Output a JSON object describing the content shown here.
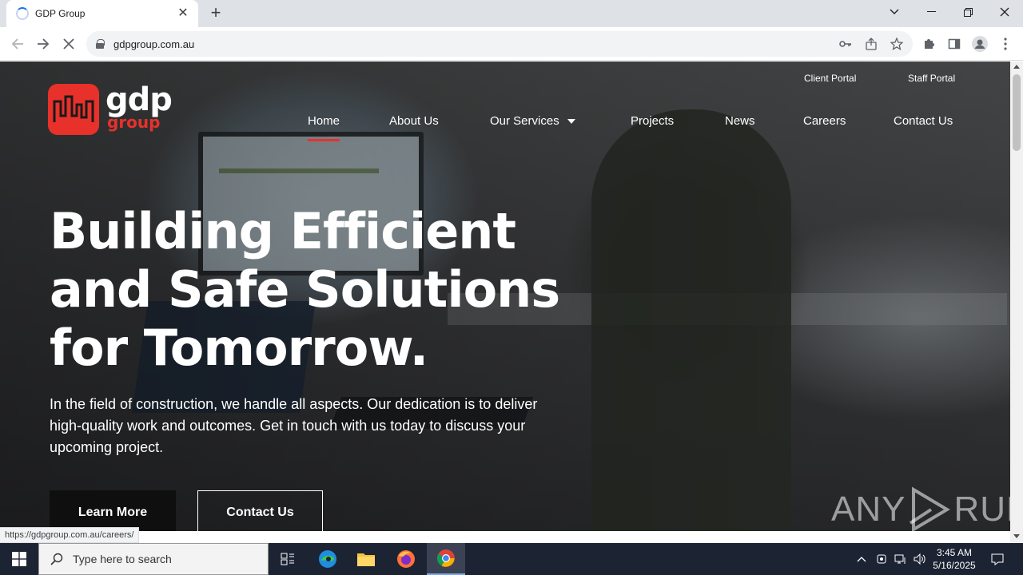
{
  "browser": {
    "tab_title": "GDP Group",
    "url": "gdpgroup.com.au",
    "status_url": "https://gdpgroup.com.au/careers/"
  },
  "site": {
    "logo_word": "gdp",
    "logo_sub": "group",
    "top_links": [
      "Client Portal",
      "Staff Portal"
    ],
    "nav": [
      "Home",
      "About Us",
      "Our Services",
      "Projects",
      "News",
      "Careers",
      "Contact Us"
    ],
    "active_nav": "Home",
    "headline_lines": [
      "Building Efficient",
      "and Safe Solutions",
      "for Tomorrow."
    ],
    "subtext_lines": [
      "In the field of construction, we handle all aspects. Our dedication is to deliver",
      "high-quality work and outcomes. Get in touch with us today to discuss your",
      "upcoming project."
    ],
    "buttons": {
      "learn_more": "Learn More",
      "contact_us": "Contact Us"
    },
    "watermark_left": "ANY",
    "watermark_right": "RUN"
  },
  "taskbar": {
    "search_placeholder": "Type here to search",
    "time": "3:45 AM",
    "date": "5/16/2025"
  },
  "colors": {
    "brand_red": "#e8312a",
    "taskbar": "#1c2434"
  }
}
